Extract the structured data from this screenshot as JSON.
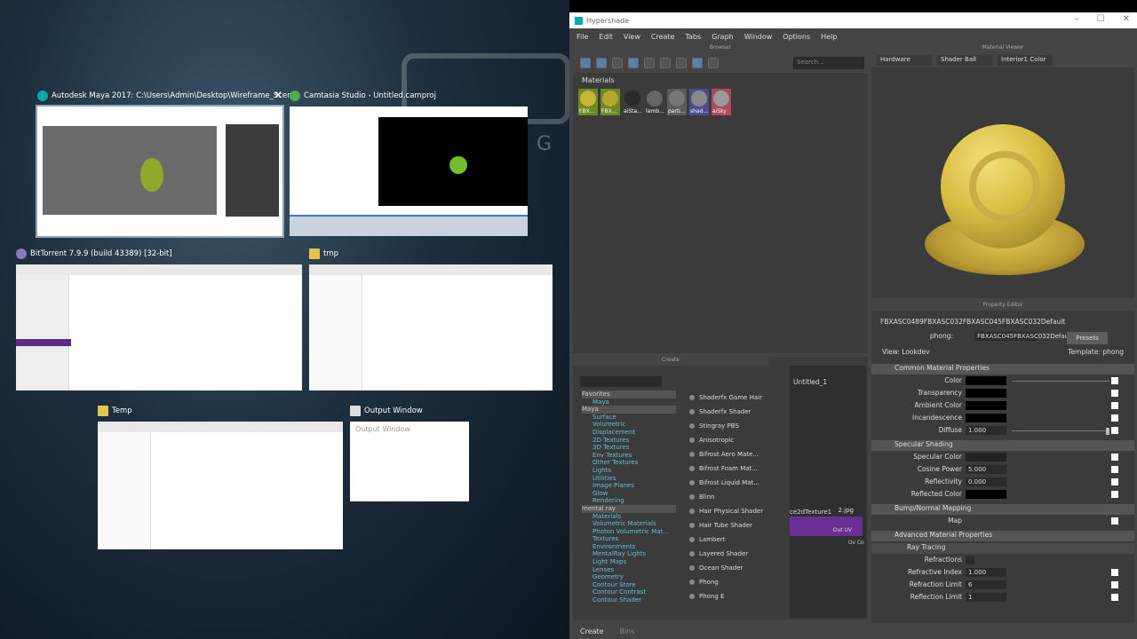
{
  "task_view": {
    "windows": [
      {
        "title": "Autodesk Maya 2017: C:\\Users\\Admin\\Desktop\\Wireframe_Scen..."
      },
      {
        "title": "Camtasia Studio - Untitled.camproj"
      },
      {
        "title": "BitTorrent 7.9.9  (build 43389) [32-bit]"
      },
      {
        "title": "tmp"
      },
      {
        "title": "Temp"
      },
      {
        "title": "Output Window",
        "content": "Output Window"
      }
    ],
    "close_glyph": "✕"
  },
  "maya": {
    "title": "Hypershade",
    "menu": [
      "File",
      "Edit",
      "View",
      "Create",
      "Tabs",
      "Graph",
      "Window",
      "Options",
      "Help"
    ],
    "browser": {
      "pane_title": "Browser",
      "search_placeholder": "Search...",
      "tab": "Materials",
      "swatches": [
        {
          "label": "FBX...",
          "color": "#c8b537",
          "bg": "#6b8a21"
        },
        {
          "label": "FBX...",
          "color": "#b6a52f",
          "bg": "#6b8a21"
        },
        {
          "label": "aiSta...",
          "color": "#2a2a2a",
          "bg": "#3a3a3a"
        },
        {
          "label": "lamb...",
          "color": "#666666",
          "bg": "#3a3a3a"
        },
        {
          "label": "parti...",
          "color": "#777777",
          "bg": "#5b5b5b"
        },
        {
          "label": "shad...",
          "color": "#888888",
          "bg": "#4b4e8c"
        },
        {
          "label": "aiSky",
          "color": "#999999",
          "bg": "#b04a5a"
        }
      ]
    },
    "viewer": {
      "pane_title": "Material Viewer",
      "renderer": "Hardware",
      "shape": "Shader Ball",
      "env": "Interior1 Color"
    },
    "property": {
      "pane_title": "Property Editor",
      "material": "FBXASC0489FBXASC032FBXASC045FBXASC032Default",
      "type_label": "phong:",
      "type_value": "FBXASC045FBXASC032Default",
      "presets": "Presets",
      "view": "View: Lookdev",
      "template": "Template: phong",
      "sections": {
        "common": "Common Material Properties",
        "specular": "Specular Shading",
        "bump": "Bump/Normal Mapping",
        "advanced": "Advanced Material Properties",
        "ray": "Ray Tracing"
      },
      "attrs": {
        "color": "Color",
        "transparency": "Transparency",
        "ambient": "Ambient Color",
        "incandescence": "Incandescence",
        "diffuse": "Diffuse",
        "diffuse_v": "1.000",
        "spec_color": "Specular Color",
        "cosine": "Cosine Power",
        "cosine_v": "5.000",
        "reflectivity": "Reflectivity",
        "reflectivity_v": "0.000",
        "reflected": "Reflected Color",
        "map": "Map",
        "refractions": "Refractions",
        "ref_index": "Refractive Index",
        "ref_index_v": "1.000",
        "ref_limit": "Refraction Limit",
        "ref_limit_v": "6",
        "refl_limit": "Reflection Limit",
        "refl_limit_v": "1"
      }
    },
    "create": {
      "pane_title": "Create",
      "tree": [
        {
          "t": "Favorites",
          "k": "hdr"
        },
        {
          "t": "Maya",
          "k": "sub"
        },
        {
          "t": "Maya",
          "k": "hl"
        },
        {
          "t": "Surface",
          "k": "sub"
        },
        {
          "t": "Volumetric",
          "k": "sub"
        },
        {
          "t": "Displacement",
          "k": "sub"
        },
        {
          "t": "2D Textures",
          "k": "sub"
        },
        {
          "t": "3D Textures",
          "k": "sub"
        },
        {
          "t": "Env Textures",
          "k": "sub"
        },
        {
          "t": "Other Textures",
          "k": "sub"
        },
        {
          "t": "Lights",
          "k": "sub"
        },
        {
          "t": "Utilities",
          "k": "sub"
        },
        {
          "t": "Image Planes",
          "k": "sub"
        },
        {
          "t": "Glow",
          "k": "sub"
        },
        {
          "t": "Rendering",
          "k": "sub"
        },
        {
          "t": "mental ray",
          "k": "hl"
        },
        {
          "t": "Materials",
          "k": "sub"
        },
        {
          "t": "Volumetric Materials",
          "k": "sub"
        },
        {
          "t": "Photon Volumetric Mat...",
          "k": "sub"
        },
        {
          "t": "Textures",
          "k": "sub"
        },
        {
          "t": "Environments",
          "k": "sub"
        },
        {
          "t": "MentalRay Lights",
          "k": "sub"
        },
        {
          "t": "Light Maps",
          "k": "sub"
        },
        {
          "t": "Lenses",
          "k": "sub"
        },
        {
          "t": "Geometry",
          "k": "sub"
        },
        {
          "t": "Contour Store",
          "k": "sub"
        },
        {
          "t": "Contour Contrast",
          "k": "sub"
        },
        {
          "t": "Contour Shader",
          "k": "sub"
        }
      ],
      "nodes": [
        "Shaderfx Game Hair",
        "Shaderfx Shader",
        "Stingray PBS",
        "Anisotropic",
        "Bifrost Aero Mate...",
        "Bifrost Foam Mat...",
        "Bifrost Liquid Mat...",
        "Blinn",
        "Hair Physical Shader",
        "Hair Tube Shader",
        "Lambert",
        "Layered Shader",
        "Ocean Shader",
        "Phong",
        "Phong E"
      ]
    },
    "graph": {
      "tab": "Untitled_1",
      "node": "ce2dTexture1",
      "file": "2.jpg",
      "out": "Out UV",
      "uv": "Uv Co"
    },
    "bottom_tabs": [
      "Create",
      "Bins"
    ]
  }
}
